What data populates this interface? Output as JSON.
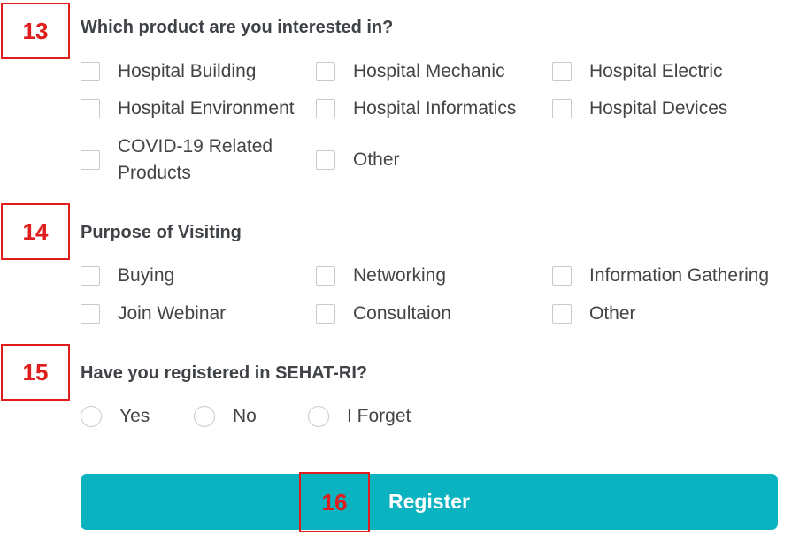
{
  "badges": {
    "b13": "13",
    "b14": "14",
    "b15": "15",
    "b16": "16"
  },
  "q13": {
    "question": "Which product are you interested in?",
    "options": [
      "Hospital Building",
      "Hospital Mechanic",
      "Hospital Electric",
      "Hospital Environment",
      "Hospital Informatics",
      "Hospital Devices",
      "COVID-19 Related",
      "Products",
      "Other"
    ]
  },
  "q14": {
    "question": "Purpose of Visiting",
    "options": [
      "Buying",
      "Networking",
      "Information Gathering",
      "Join Webinar",
      "Consultaion",
      "Other"
    ]
  },
  "q15": {
    "question": "Have you registered in SEHAT-RI?",
    "options": [
      "Yes",
      "No",
      "I Forget"
    ]
  },
  "register": {
    "label": "Register"
  },
  "colors": {
    "accent": "#0bb3c0",
    "annotation": "#e01c1c"
  }
}
